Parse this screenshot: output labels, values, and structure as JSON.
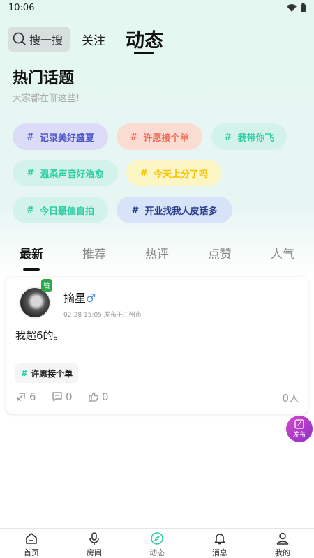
{
  "status_bar": {
    "time": "10:06"
  },
  "top_nav": {
    "search_label": "搜一搜",
    "follow_label": "关注",
    "dynamic_label": "动态"
  },
  "hot_topics": {
    "title": "热门话题",
    "subtitle": "大家都在聊这些!",
    "chips": [
      {
        "label": "记录美好盛夏",
        "color": "#4a54c8",
        "bg": "#dcdcf9"
      },
      {
        "label": "许愿接个单",
        "color": "#f06a55",
        "bg": "#fbdcd3"
      },
      {
        "label": "我带你飞",
        "color": "#2ecfa5",
        "bg": "#d3f3ea"
      },
      {
        "label": "温柔声音好治愈",
        "color": "#2ecfa5",
        "bg": "#d3f3ea"
      },
      {
        "label": "今天上分了吗",
        "color": "#f5c400",
        "bg": "#fcf5c4"
      },
      {
        "label": "今日最佳自拍",
        "color": "#2ecfa5",
        "bg": "#d3f3ea"
      },
      {
        "label": "开业找我人皮话多",
        "color": "#2b3f8c",
        "bg": "#d7e3f8"
      }
    ]
  },
  "feed_tabs": [
    "最新",
    "推荐",
    "热评",
    "点赞",
    "人气"
  ],
  "post": {
    "badge": "管",
    "username": "摘星",
    "gender_symbol": "♂",
    "meta": "02-28 15:05 发布于广州市",
    "content": "我超6的。",
    "tag": "许愿接个单",
    "shares": "6",
    "comments": "0",
    "likes": "0",
    "people": "0人"
  },
  "publish_button": {
    "label": "发布"
  },
  "bottom_nav": [
    {
      "label": "首页",
      "icon": "home-icon"
    },
    {
      "label": "房间",
      "icon": "microphone-icon"
    },
    {
      "label": "动态",
      "icon": "compass-icon"
    },
    {
      "label": "消息",
      "icon": "bell-icon"
    },
    {
      "label": "我的",
      "icon": "person-icon"
    }
  ],
  "colors": {
    "accent_green": "#2ecfa5",
    "publish_purple": "#b23fc9"
  }
}
